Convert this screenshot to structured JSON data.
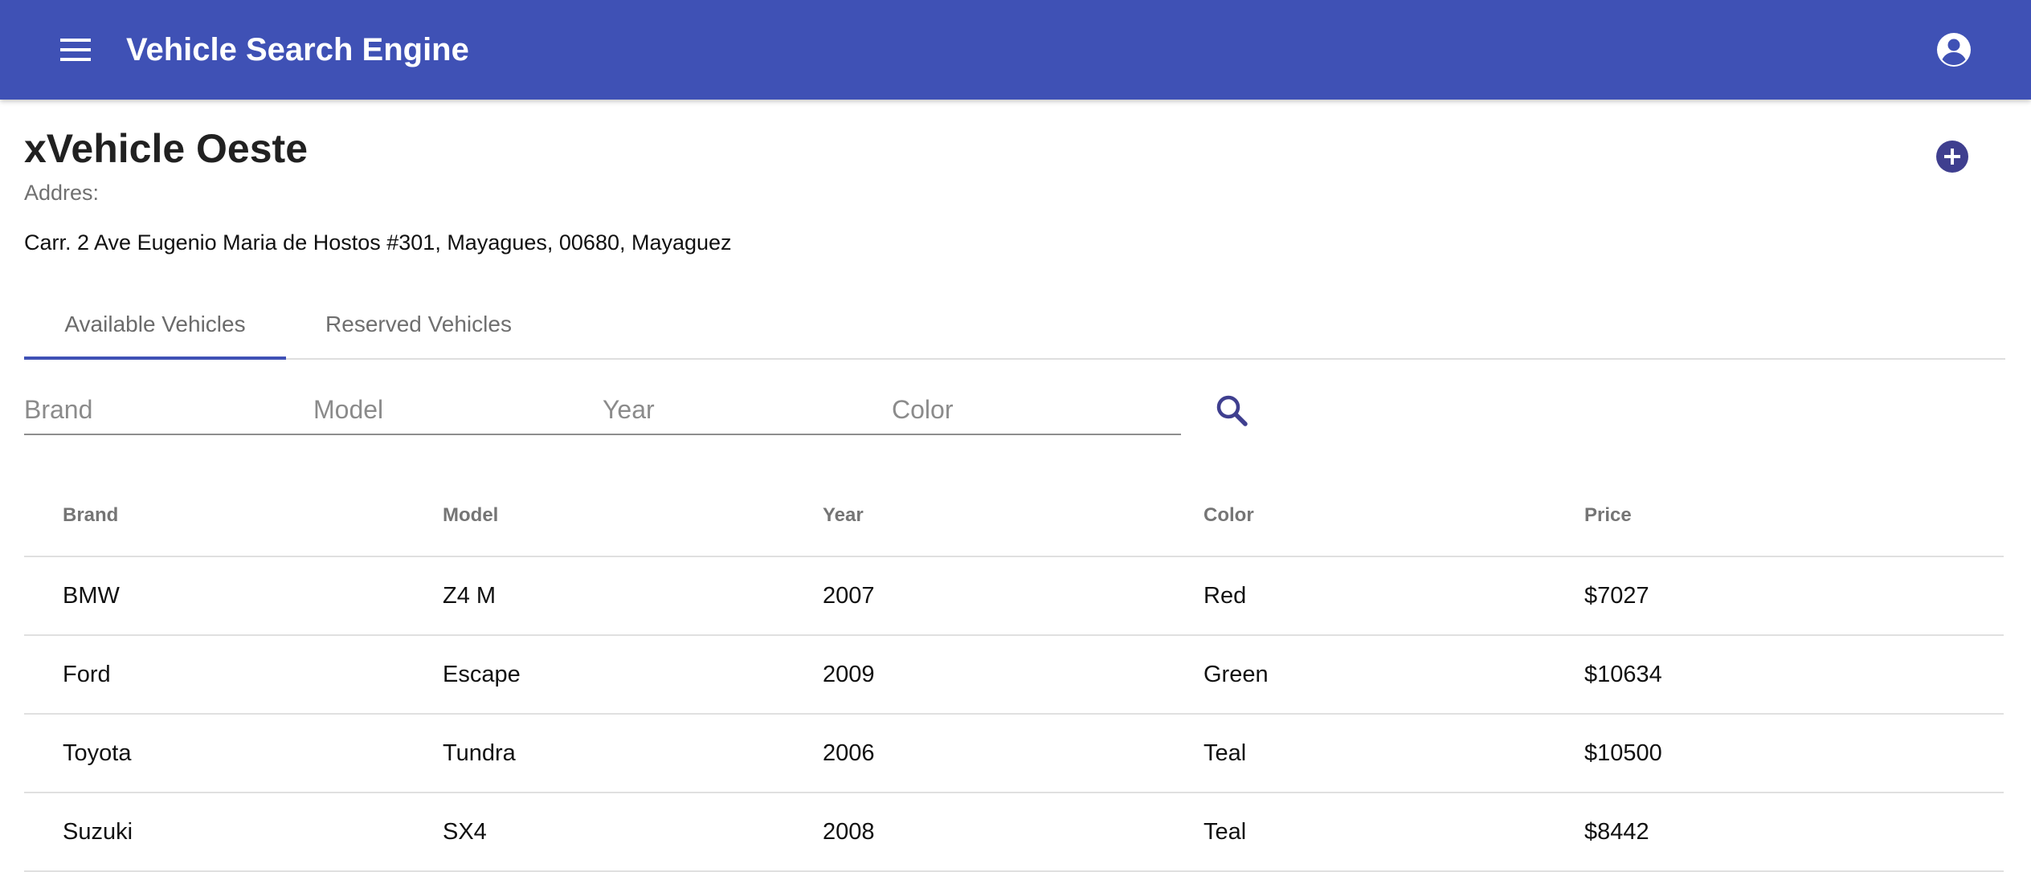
{
  "app_bar": {
    "title": "Vehicle Search Engine",
    "menu_icon": "menu-icon",
    "account_icon": "account-circle-icon",
    "background": "#3f51b5"
  },
  "store": {
    "name": "xVehicle Oeste",
    "address_label": "Addres:",
    "address": "Carr. 2 Ave Eugenio Maria de Hostos #301, Mayagues, 00680, Mayaguez",
    "add_icon": "add-circle-icon",
    "accent": "#3f3f8f"
  },
  "tabs": [
    {
      "label": "Available Vehicles",
      "active": true
    },
    {
      "label": "Reserved Vehicles",
      "active": false
    }
  ],
  "filters": {
    "brand": {
      "placeholder": "Brand",
      "value": ""
    },
    "model": {
      "placeholder": "Model",
      "value": ""
    },
    "year": {
      "placeholder": "Year",
      "value": ""
    },
    "color": {
      "placeholder": "Color",
      "value": ""
    },
    "search_icon": "search-icon"
  },
  "table": {
    "headers": [
      "Brand",
      "Model",
      "Year",
      "Color",
      "Price"
    ],
    "rows": [
      [
        "BMW",
        "Z4 M",
        "2007",
        "Red",
        "$7027"
      ],
      [
        "Ford",
        "Escape",
        "2009",
        "Green",
        "$10634"
      ],
      [
        "Toyota",
        "Tundra",
        "2006",
        "Teal",
        "$10500"
      ],
      [
        "Suzuki",
        "SX4",
        "2008",
        "Teal",
        "$8442"
      ]
    ]
  }
}
